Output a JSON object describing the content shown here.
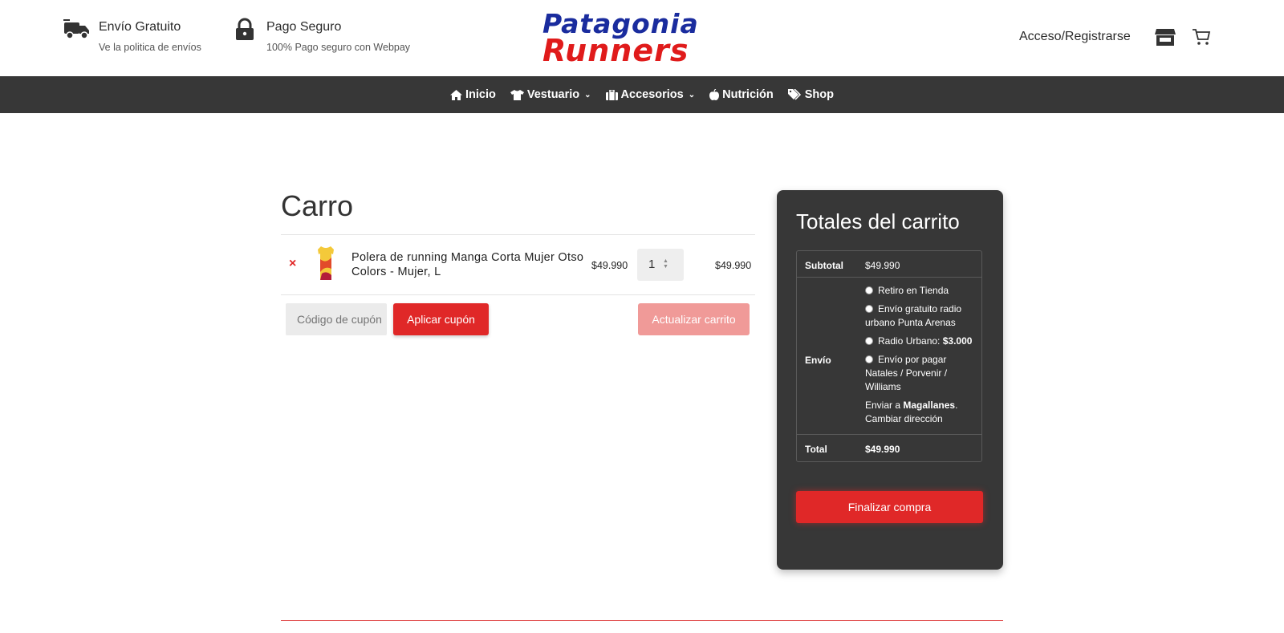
{
  "header": {
    "features": [
      {
        "title": "Envío Gratuito",
        "subtitle": "Ve la politica de envíos",
        "icon": "truck-icon"
      },
      {
        "title": "Pago Seguro",
        "subtitle": "100% Pago seguro con Webpay",
        "icon": "lock-icon"
      }
    ],
    "logo": {
      "line1": "Patagonia",
      "line2": "Runners"
    },
    "account_label": "Acceso/Registrarse",
    "icons": [
      "store-icon",
      "cart-icon"
    ]
  },
  "nav": {
    "items": [
      {
        "label": "Inicio",
        "icon": "home-icon",
        "dropdown": false
      },
      {
        "label": "Vestuario",
        "icon": "shirt-icon",
        "dropdown": true
      },
      {
        "label": "Accesorios",
        "icon": "briefcase-icon",
        "dropdown": true
      },
      {
        "label": "Nutrición",
        "icon": "apple-icon",
        "dropdown": false
      },
      {
        "label": "Shop",
        "icon": "tags-icon",
        "dropdown": false
      }
    ]
  },
  "cart": {
    "title": "Carro",
    "items": [
      {
        "remove": "×",
        "name": "Polera de running Manga Corta Mujer Otso Colors - Mujer, L",
        "price": "$49.990",
        "quantity": "1",
        "subtotal": "$49.990"
      }
    ],
    "coupon_placeholder": "Código de cupón",
    "apply_label": "Aplicar cupón",
    "update_label": "Actualizar carrito"
  },
  "totals": {
    "title": "Totales del carrito",
    "subtotal_label": "Subtotal",
    "subtotal_value": "$49.990",
    "shipping_label": "Envío",
    "shipping_options": [
      {
        "label": "Retiro en Tienda"
      },
      {
        "label": "Envío gratuito radio urbano Punta Arenas"
      },
      {
        "label": "Radio Urbano:",
        "price": "$3.000"
      },
      {
        "label": "Envío por pagar Natales / Porvenir / Williams"
      }
    ],
    "ship_to_prefix": "Enviar a",
    "ship_to_region": "Magallanes",
    "change_address": "Cambiar dirección",
    "total_label": "Total",
    "total_value": "$49.990",
    "checkout_label": "Finalizar compra"
  },
  "colors": {
    "accent": "#e02828",
    "nav_bg": "#373737",
    "logo_blue": "#1a2c9e",
    "logo_red": "#e01b1b"
  }
}
